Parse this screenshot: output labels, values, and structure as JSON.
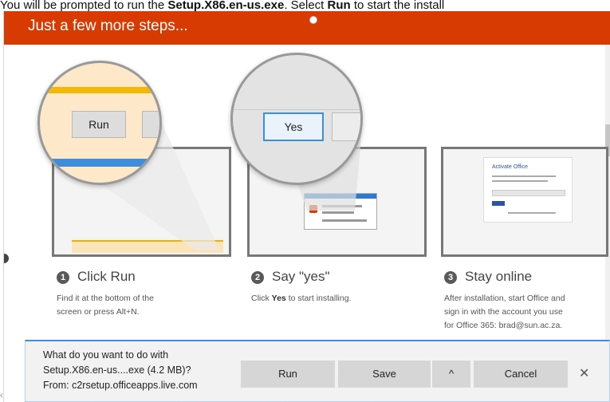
{
  "caption": {
    "prefix": "You will be prompted to run the ",
    "file": "Setup.X86.en-us.exe",
    "middle": ". Select ",
    "run_word": "Run",
    "suffix": " to start the install"
  },
  "banner": {
    "title": "Just a few more steps...",
    "color": "#d83b01"
  },
  "illustrations": {
    "zoom1_button": "Run",
    "zoom2_button": "Yes",
    "activate_title": "Activate Office"
  },
  "steps": [
    {
      "number": "1",
      "title": "Click Run",
      "desc_line1": "Find it at the bottom of the",
      "desc_line2": "screen or press Alt+N."
    },
    {
      "number": "2",
      "title": "Say \"yes\"",
      "desc_bold": "Yes",
      "desc_prefix": "Click ",
      "desc_suffix": " to start installing."
    },
    {
      "number": "3",
      "title": "Stay online",
      "desc_line1": "After installation, start Office and",
      "desc_line2": "sign in with the account you use",
      "desc_line3": "for Office 365: brad@sun.ac.za."
    }
  ],
  "download_bar": {
    "line1": "What do you want to do with",
    "line2": "Setup.X86.en-us....exe (4.2 MB)?",
    "line3": "From: c2rsetup.officeapps.live.com",
    "run_label": "Run",
    "save_label": "Save",
    "chevron": "^",
    "cancel_label": "Cancel",
    "close_glyph": "✕"
  },
  "icons": {
    "close": "close-icon",
    "chevron": "chevron-up-icon"
  }
}
